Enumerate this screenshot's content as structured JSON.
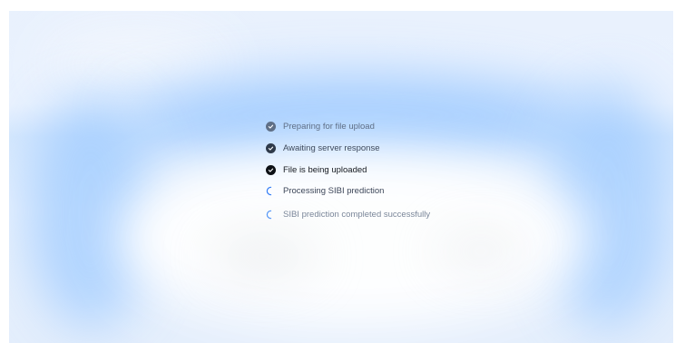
{
  "accent_spinner_color": "#3b82f6",
  "steps": [
    {
      "label": "Preparing for file upload",
      "status": "done",
      "icon": "check-circle-icon"
    },
    {
      "label": "Awaiting server response",
      "status": "done",
      "icon": "check-circle-icon"
    },
    {
      "label": "File is being uploaded",
      "status": "done",
      "icon": "check-circle-icon"
    },
    {
      "label": "Processing SIBI prediction",
      "status": "in-progress",
      "icon": "spinner-icon"
    },
    {
      "label": "SIBI prediction completed successfully",
      "status": "pending",
      "icon": "spinner-icon"
    }
  ]
}
